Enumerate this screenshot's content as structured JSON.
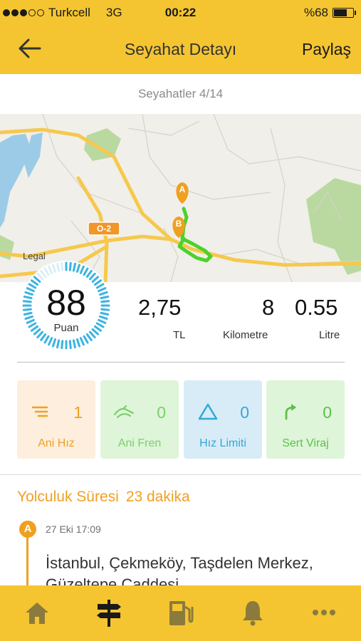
{
  "status_bar": {
    "carrier": "Turkcell",
    "network": "3G",
    "time": "00:22",
    "battery": "%68",
    "battery_level": 0.68
  },
  "nav": {
    "title": "Seyahat Detayı",
    "share_label": "Paylaş"
  },
  "trip_counter": "Seyahatler 4/14",
  "map": {
    "road_badge": "O-2",
    "legal_label": "Legal",
    "start_marker": "A",
    "end_marker": "B"
  },
  "score": {
    "value": "88",
    "label": "Puan"
  },
  "stats": [
    {
      "value": "2,75",
      "label": "TL"
    },
    {
      "value": "8",
      "label": "Kilometre"
    },
    {
      "value": "0.55",
      "label": "Litre"
    }
  ],
  "events": [
    {
      "label": "Ani Hız",
      "count": "1",
      "icon": "acceleration-icon",
      "bg": "#fdeedd",
      "color": "#f0a020"
    },
    {
      "label": "Ani Fren",
      "count": "0",
      "icon": "braking-icon",
      "bg": "#def5d9",
      "color": "#7bd06a"
    },
    {
      "label": "Hız Limiti",
      "count": "0",
      "icon": "speed-limit-icon",
      "bg": "#d8ecf7",
      "color": "#34a8d6"
    },
    {
      "label": "Sert Viraj",
      "count": "0",
      "icon": "sharp-turn-icon",
      "bg": "#def5d9",
      "color": "#5cc04a"
    }
  ],
  "journey": {
    "duration_label": "Yolculuk Süresi",
    "duration_value": "23 dakika",
    "start_marker": "A",
    "start_time": "27 Eki 17:09",
    "start_address": "İstanbul, Çekmeköy, Taşdelen Merkez, Güzeltepe Caddesi"
  },
  "tabs": [
    "home-icon",
    "trips-signpost-icon",
    "fuel-pump-icon",
    "notifications-bell-icon",
    "more-icon"
  ],
  "colors": {
    "accent": "#f4c531",
    "orange": "#f0a020",
    "route": "#4cd22a",
    "ring": "#3bb3e0"
  }
}
